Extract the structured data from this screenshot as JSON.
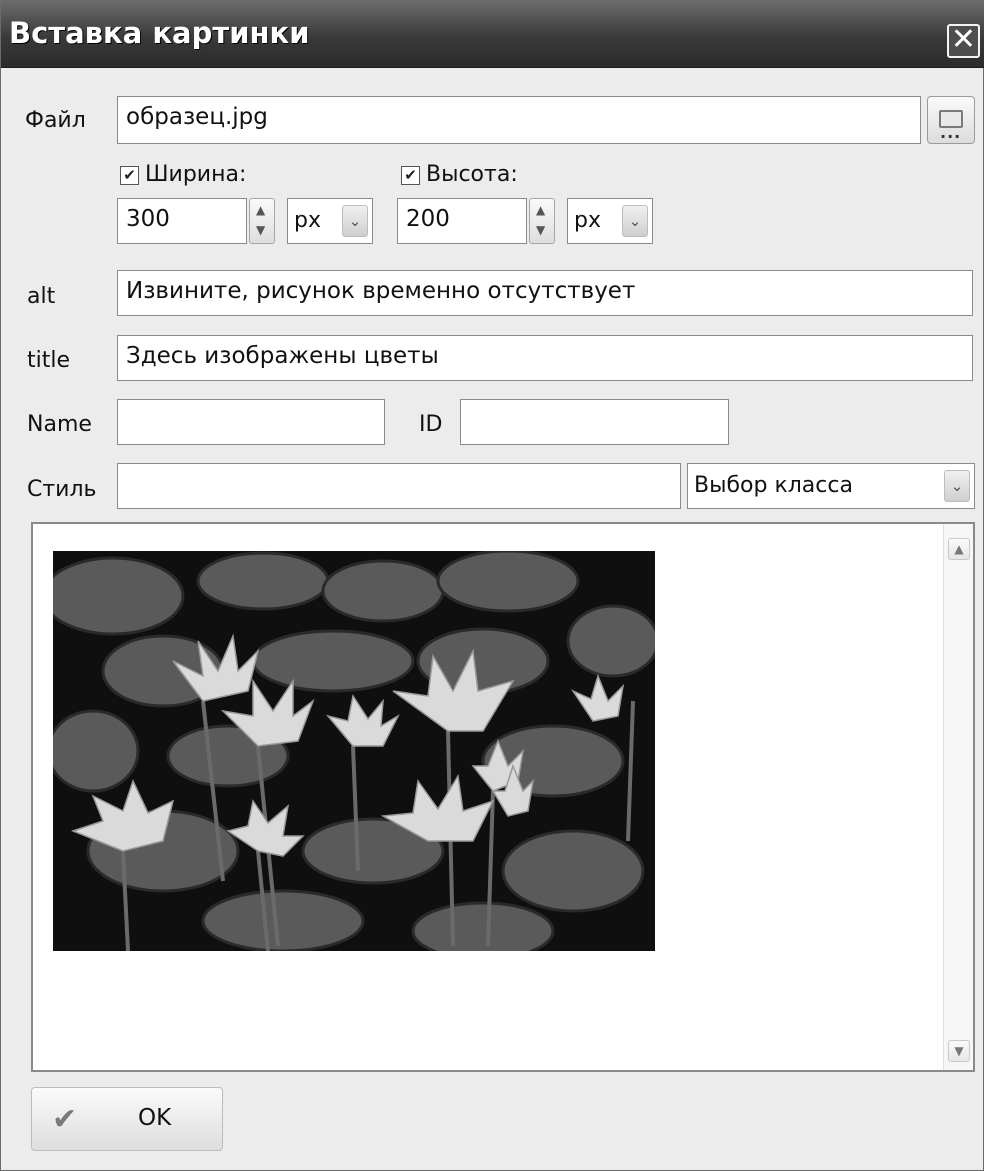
{
  "window": {
    "title": "Вставка картинки",
    "close_glyph": "✕"
  },
  "file": {
    "label": "Файл",
    "value": "образец.jpg",
    "browse_dots": "..."
  },
  "width": {
    "checked": true,
    "label": "Ширина:",
    "value": "300",
    "unit": "px"
  },
  "height": {
    "checked": true,
    "label": "Высота:",
    "value": "200",
    "unit": "px"
  },
  "alt": {
    "label": "alt",
    "value": "Извините, рисунок временно отсутствует"
  },
  "title_attr": {
    "label": "title",
    "value": "Здесь изображены цветы"
  },
  "name": {
    "label": "Name",
    "value": ""
  },
  "id": {
    "label": "ID",
    "value": ""
  },
  "style": {
    "label": "Стиль",
    "value": "",
    "class_select": "Выбор класса"
  },
  "preview": {
    "icon": "image-preview"
  },
  "buttons": {
    "ok_label": "OK"
  },
  "icons": {
    "check": "✔",
    "up": "▲",
    "down": "▼",
    "chevron": "⌄"
  }
}
